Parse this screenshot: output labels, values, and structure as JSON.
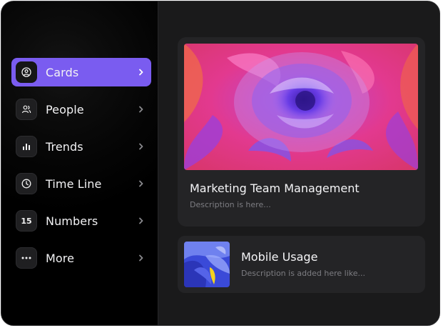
{
  "sidebar": {
    "items": [
      {
        "label": "Cards",
        "icon": "user-circle-icon",
        "active": true
      },
      {
        "label": "People",
        "icon": "people-icon",
        "active": false
      },
      {
        "label": "Trends",
        "icon": "bar-chart-icon",
        "active": false
      },
      {
        "label": "Time Line",
        "icon": "clock-icon",
        "active": false
      },
      {
        "label": "Numbers",
        "icon": "number-icon",
        "badge": "15",
        "active": false
      },
      {
        "label": "More",
        "icon": "more-dots-icon",
        "active": false
      }
    ]
  },
  "main": {
    "cards": [
      {
        "title": "Marketing Team Management",
        "description": "Description is here...",
        "image": "abstract-flower-image"
      },
      {
        "title": "Mobile Usage",
        "description": "Description is added here like...",
        "image": "iris-flower-image"
      }
    ]
  },
  "colors": {
    "accent": "#7a5cf0",
    "sidebar_bg": "#000000",
    "main_bg": "#1a1a1b",
    "card_bg": "#242426",
    "text_primary": "#f5f5f7",
    "text_secondary": "#7d7d82"
  }
}
